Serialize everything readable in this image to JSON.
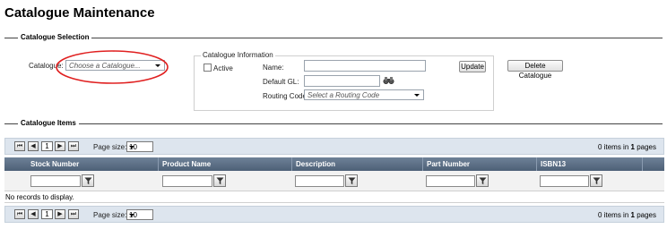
{
  "page": {
    "title": "Catalogue Maintenance"
  },
  "selection": {
    "section_title": "Catalogue Selection",
    "catalogue_label": "Catalogue:",
    "catalogue_placeholder": "Choose a Catalogue...",
    "highlight_color": "#e02020"
  },
  "info": {
    "legend": "Catalogue Information",
    "active_label": "Active",
    "active_checked": false,
    "name_label": "Name:",
    "name_value": "",
    "default_gl_label": "Default GL:",
    "default_gl_value": "",
    "routing_label": "Routing Code:",
    "routing_placeholder": "Select a Routing Code",
    "update_button": "Update",
    "delete_button": "Delete Catalogue"
  },
  "items": {
    "section_title": "Catalogue Items",
    "pager": {
      "first": "⏮",
      "prev": "◀",
      "page": "1",
      "next": "▶",
      "last": "⏭",
      "page_size_label": "Page size:",
      "page_size_value": "10",
      "items_count": "0",
      "items_text": "items in",
      "pages_count": "1",
      "pages_text": "pages"
    },
    "columns": [
      "Stock Number",
      "Product Name",
      "Description",
      "Part Number",
      "ISBN13"
    ],
    "no_records": "No records to display.",
    "header_color": "#5a6d84"
  }
}
